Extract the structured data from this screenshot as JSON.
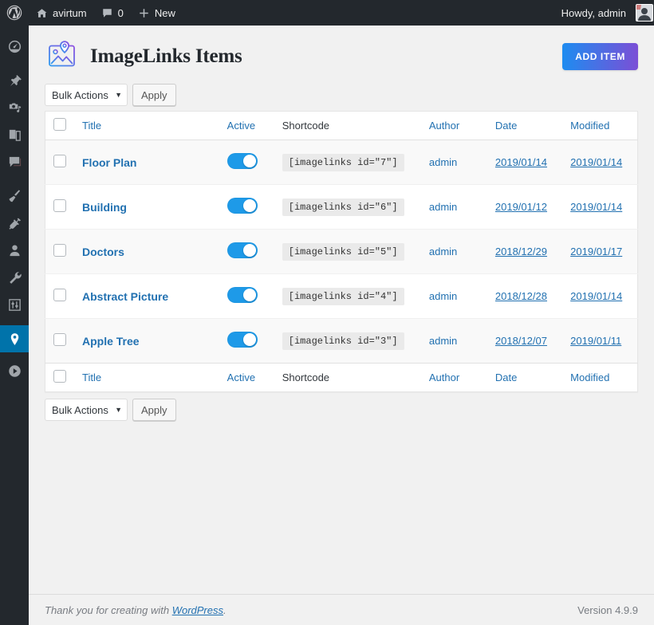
{
  "adminbar": {
    "wp_logo_icon": "wordpress-logo-icon",
    "site_home_icon": "home-icon",
    "site_name": "avirtum",
    "comments_icon": "comment-bubble-icon",
    "comments_count": "0",
    "new_icon": "plus-icon",
    "new_label": "New",
    "howdy": "Howdy, admin",
    "avatar_icon": "user-avatar-icon"
  },
  "sidebar": {
    "items": [
      {
        "name": "dashboard",
        "icon": "dashboard-gauge-icon",
        "current": false
      },
      {
        "name": "posts",
        "icon": "pin-icon",
        "current": false
      },
      {
        "name": "media",
        "icon": "media-camera-music-icon",
        "current": false
      },
      {
        "name": "pages",
        "icon": "pages-icon",
        "current": false
      },
      {
        "name": "comments",
        "icon": "comment-bubble-icon",
        "current": false
      },
      {
        "name": "appearance",
        "icon": "paintbrush-icon",
        "current": false
      },
      {
        "name": "plugins",
        "icon": "plug-icon",
        "current": false
      },
      {
        "name": "users",
        "icon": "user-icon",
        "current": false
      },
      {
        "name": "tools",
        "icon": "wrench-icon",
        "current": false
      },
      {
        "name": "settings",
        "icon": "settings-sliders-icon",
        "current": false
      },
      {
        "name": "imagelinks",
        "icon": "map-pin-icon",
        "current": true
      },
      {
        "name": "collapse-menu",
        "icon": "play-circle-icon",
        "current": false
      }
    ],
    "current_color": "#0073aa"
  },
  "header": {
    "logo_icon": "imagelinks-photo-pin-icon",
    "title": "ImageLinks Items",
    "add_item_label": "ADD ITEM",
    "add_item_gradient_from": "#1e8cf0",
    "add_item_gradient_to": "#7b4fd6"
  },
  "tablenav": {
    "bulk_actions_label": "Bulk Actions",
    "bulk_caret_icon": "chevron-down-icon",
    "apply_label": "Apply"
  },
  "table": {
    "columns": [
      {
        "key": "cb",
        "label": "",
        "link": false
      },
      {
        "key": "title",
        "label": "Title",
        "link": true
      },
      {
        "key": "active",
        "label": "Active",
        "link": true
      },
      {
        "key": "shortcode",
        "label": "Shortcode",
        "link": false
      },
      {
        "key": "author",
        "label": "Author",
        "link": true
      },
      {
        "key": "date",
        "label": "Date",
        "link": true
      },
      {
        "key": "modified",
        "label": "Modified",
        "link": true
      }
    ],
    "rows": [
      {
        "title": "Floor Plan",
        "active": true,
        "shortcode": "[imagelinks id=\"7\"]",
        "author": "admin",
        "date": "2019/01/14",
        "modified": "2019/01/14"
      },
      {
        "title": "Building",
        "active": true,
        "shortcode": "[imagelinks id=\"6\"]",
        "author": "admin",
        "date": "2019/01/12",
        "modified": "2019/01/14"
      },
      {
        "title": "Doctors",
        "active": true,
        "shortcode": "[imagelinks id=\"5\"]",
        "author": "admin",
        "date": "2018/12/29",
        "modified": "2019/01/17"
      },
      {
        "title": "Abstract Picture",
        "active": true,
        "shortcode": "[imagelinks id=\"4\"]",
        "author": "admin",
        "date": "2018/12/28",
        "modified": "2019/01/14"
      },
      {
        "title": "Apple Tree",
        "active": true,
        "shortcode": "[imagelinks id=\"3\"]",
        "author": "admin",
        "date": "2018/12/07",
        "modified": "2019/01/11"
      }
    ],
    "toggle_on_color": "#1e9ae8"
  },
  "footer": {
    "thanks_prefix": "Thank you for creating with ",
    "wordpress_link": "WordPress",
    "thanks_suffix": ".",
    "version": "Version 4.9.9"
  }
}
